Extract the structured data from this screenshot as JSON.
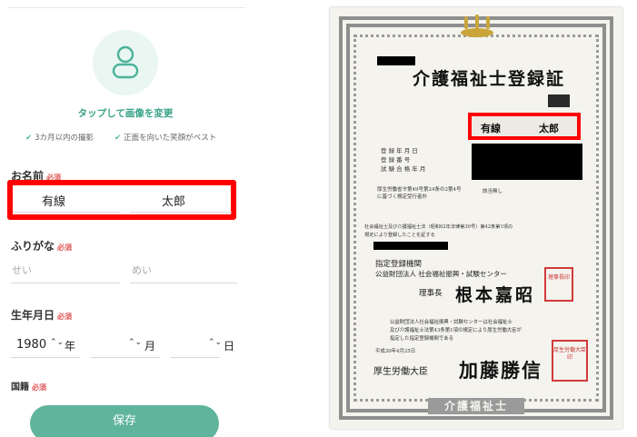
{
  "form": {
    "photo_link": "タップして画像を変更",
    "hints": [
      "3カ月以内の撮影",
      "正面を向いた笑顔がベスト"
    ],
    "name": {
      "label": "お名前",
      "required": "必須",
      "last": "有線",
      "first": "太郎"
    },
    "furigana": {
      "label": "ふりがな",
      "required": "必須",
      "last_placeholder": "せい",
      "first_placeholder": "めい"
    },
    "birthdate": {
      "label": "生年月日",
      "required": "必須",
      "year": "1980",
      "year_unit": "年",
      "month_unit": "月",
      "day_unit": "日"
    },
    "nationality": {
      "label": "国籍",
      "required": "必須"
    },
    "save_label": "保存"
  },
  "certificate": {
    "title": "介護福祉士登録証",
    "holder_last": "有線",
    "holder_first": "太郎",
    "fields": [
      "登 録 年 月 日",
      "登 録 番 号",
      "試 験 合 格 年 月"
    ],
    "law_line1": "厚生労働省令第49号第24条の2第4号",
    "law_line2": "に基づく規定受行者外",
    "note": "該当無し",
    "body1": "社会福祉士及び介護福祉士法（昭和62年法律第30号）第42条第1項の",
    "body2": "規定により登録したことを証する",
    "agency_heading": "指定登録機関",
    "agency": "公益財団法人 社会福祉振興・試験センター",
    "director_title": "理事長",
    "director_name": "根本嘉昭",
    "foot1": "公益財団法人社会福祉振興・試験センターは社会福祉士",
    "foot2": "及び介護福祉士法第43条第1項の規定により厚生労働大臣が",
    "foot3": "指定した指定登録機関である",
    "foot_date": "平成30年4月25日",
    "minister_title": "厚生労働大臣",
    "minister_name": "加藤勝信",
    "bottom_emblem": "介護福祉士",
    "seal1": "理事長印",
    "seal2": "厚生労働大臣印"
  }
}
